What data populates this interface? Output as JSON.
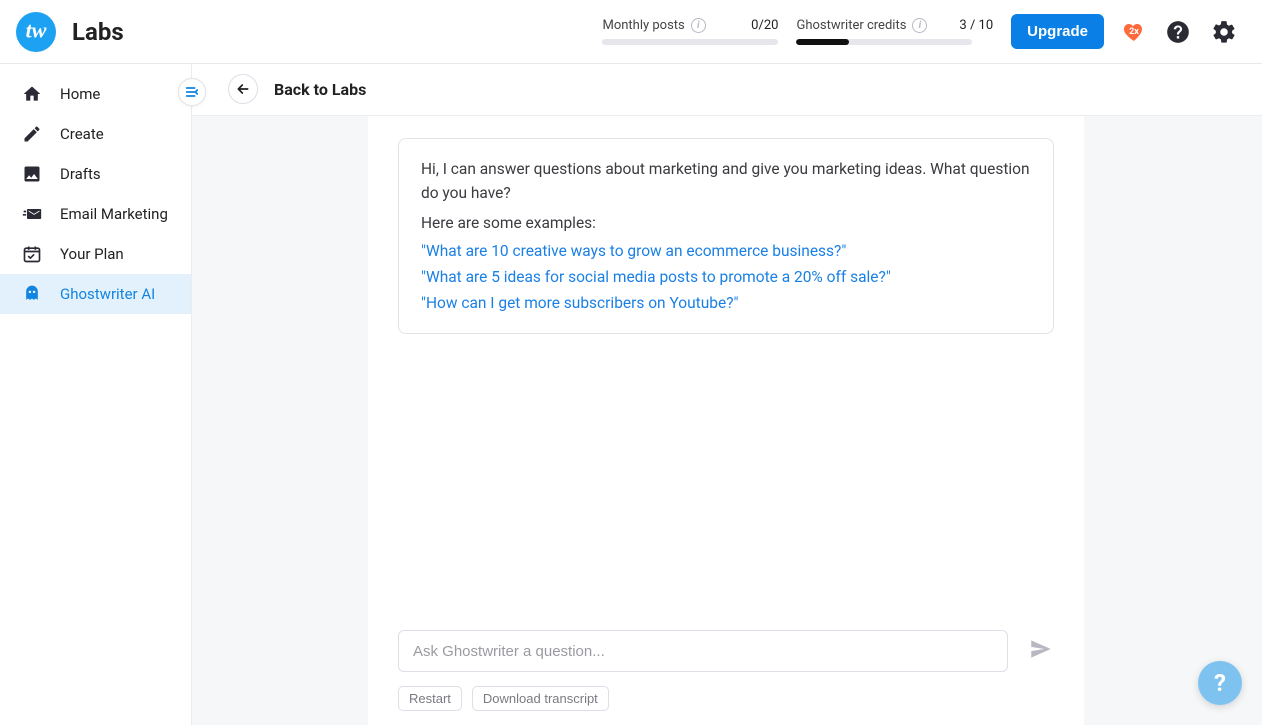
{
  "header": {
    "page_title": "Labs",
    "monthly_posts": {
      "label": "Monthly posts",
      "value": "0/20",
      "fill_ratio": 0
    },
    "ghostwriter_credits": {
      "label": "Ghostwriter credits",
      "value": "3 / 10",
      "fill_ratio": 0.3
    },
    "upgrade_label": "Upgrade"
  },
  "sidebar": {
    "items": [
      {
        "label": "Home"
      },
      {
        "label": "Create"
      },
      {
        "label": "Drafts"
      },
      {
        "label": "Email Marketing"
      },
      {
        "label": "Your Plan"
      },
      {
        "label": "Ghostwriter AI"
      }
    ]
  },
  "subheader": {
    "back_label": "Back to Labs"
  },
  "chat": {
    "intro": "Hi, I can answer questions about marketing and give you marketing ideas. What question do you have?",
    "examples_label": "Here are some examples:",
    "example1": "\"What are 10 creative ways to grow an ecommerce business?\"",
    "example2": "\"What are 5 ideas for social media posts to promote a 20% off sale?\"",
    "example3": "\"How can I get more subscribers on Youtube?\""
  },
  "composer": {
    "placeholder": "Ask Ghostwriter a question...",
    "restart_label": "Restart",
    "download_label": "Download transcript"
  }
}
